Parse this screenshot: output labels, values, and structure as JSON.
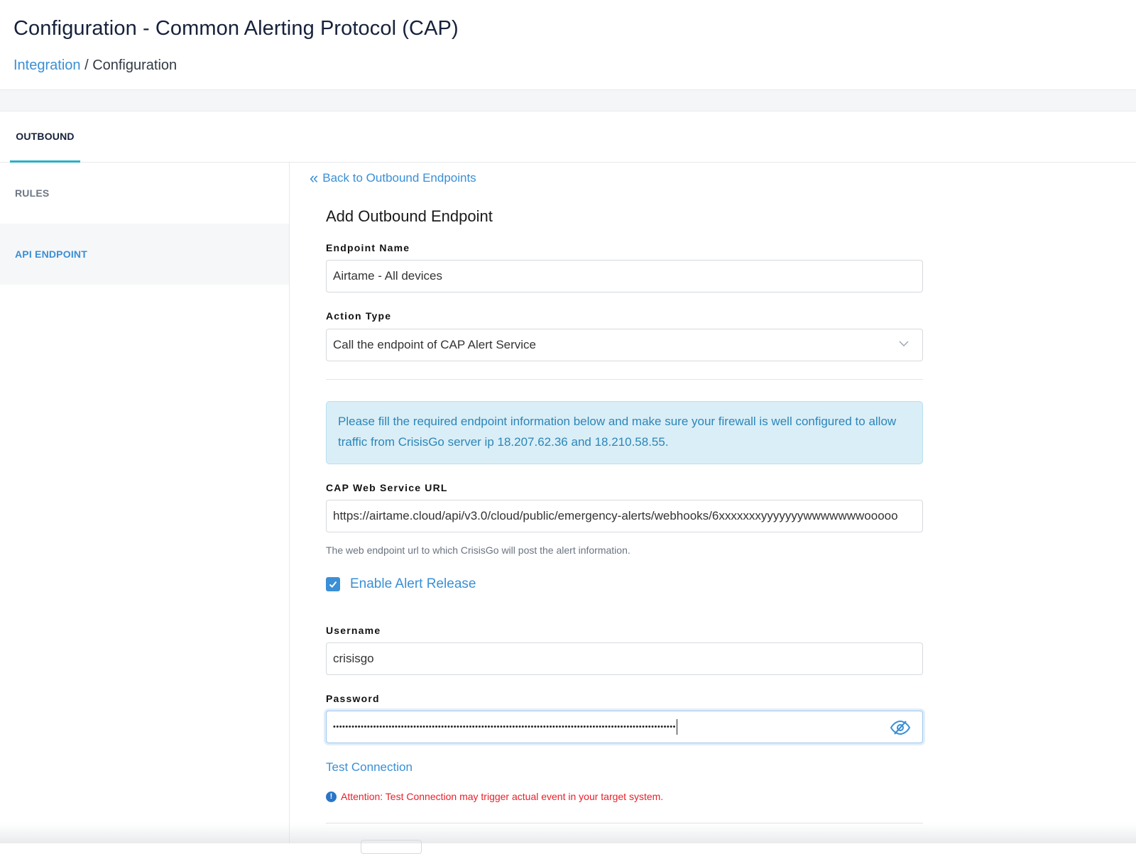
{
  "header": {
    "title": "Configuration - Common Alerting Protocol (CAP)",
    "breadcrumb": {
      "link": "Integration",
      "separator": " / ",
      "current": "Configuration"
    }
  },
  "tabs": [
    {
      "label": "OUTBOUND",
      "active": true
    }
  ],
  "sidebar": {
    "items": [
      {
        "label": "RULES",
        "active": false
      },
      {
        "label": "API ENDPOINT",
        "active": true
      }
    ]
  },
  "back_link": "Back to Outbound Endpoints",
  "form": {
    "title": "Add Outbound Endpoint",
    "endpoint_name": {
      "label": "Endpoint Name",
      "value": "Airtame - All devices"
    },
    "action_type": {
      "label": "Action Type",
      "value": "Call the endpoint of CAP Alert Service"
    },
    "info_message": "Please fill the required endpoint information below and make sure your firewall is well configured to allow traffic from CrisisGo server ip 18.207.62.36 and 18.210.58.55.",
    "cap_url": {
      "label": "CAP Web Service URL",
      "value": "https://airtame.cloud/api/v3.0/cloud/public/emergency-alerts/webhooks/6xxxxxxxyyyyyyywwwwwwwooooo",
      "help": "The web endpoint url to which CrisisGo will post the alert information."
    },
    "enable_alert_release": {
      "label": "Enable Alert Release",
      "checked": true
    },
    "username": {
      "label": "Username",
      "value": "crisisgo"
    },
    "password": {
      "label": "Password",
      "value": "•••••••••••••••••••••••••••••••••••••••••••••••••••••••••••••••••••••••••••••••••••••••••••••••••••••••••••••••"
    },
    "test_connection": "Test Connection",
    "attention": "Attention: Test Connection may trigger actual event in your target system."
  },
  "colors": {
    "accent": "#3a8fd6",
    "tab_underline": "#2ab0c6",
    "info_bg": "#daeef7",
    "warning": "#e8202a"
  },
  "icons": {
    "back": "double-chevron-left-icon",
    "select": "chevron-down-icon",
    "password_toggle": "eye-slash-icon",
    "attention": "info-circle-icon",
    "checkbox": "checkmark-icon"
  }
}
